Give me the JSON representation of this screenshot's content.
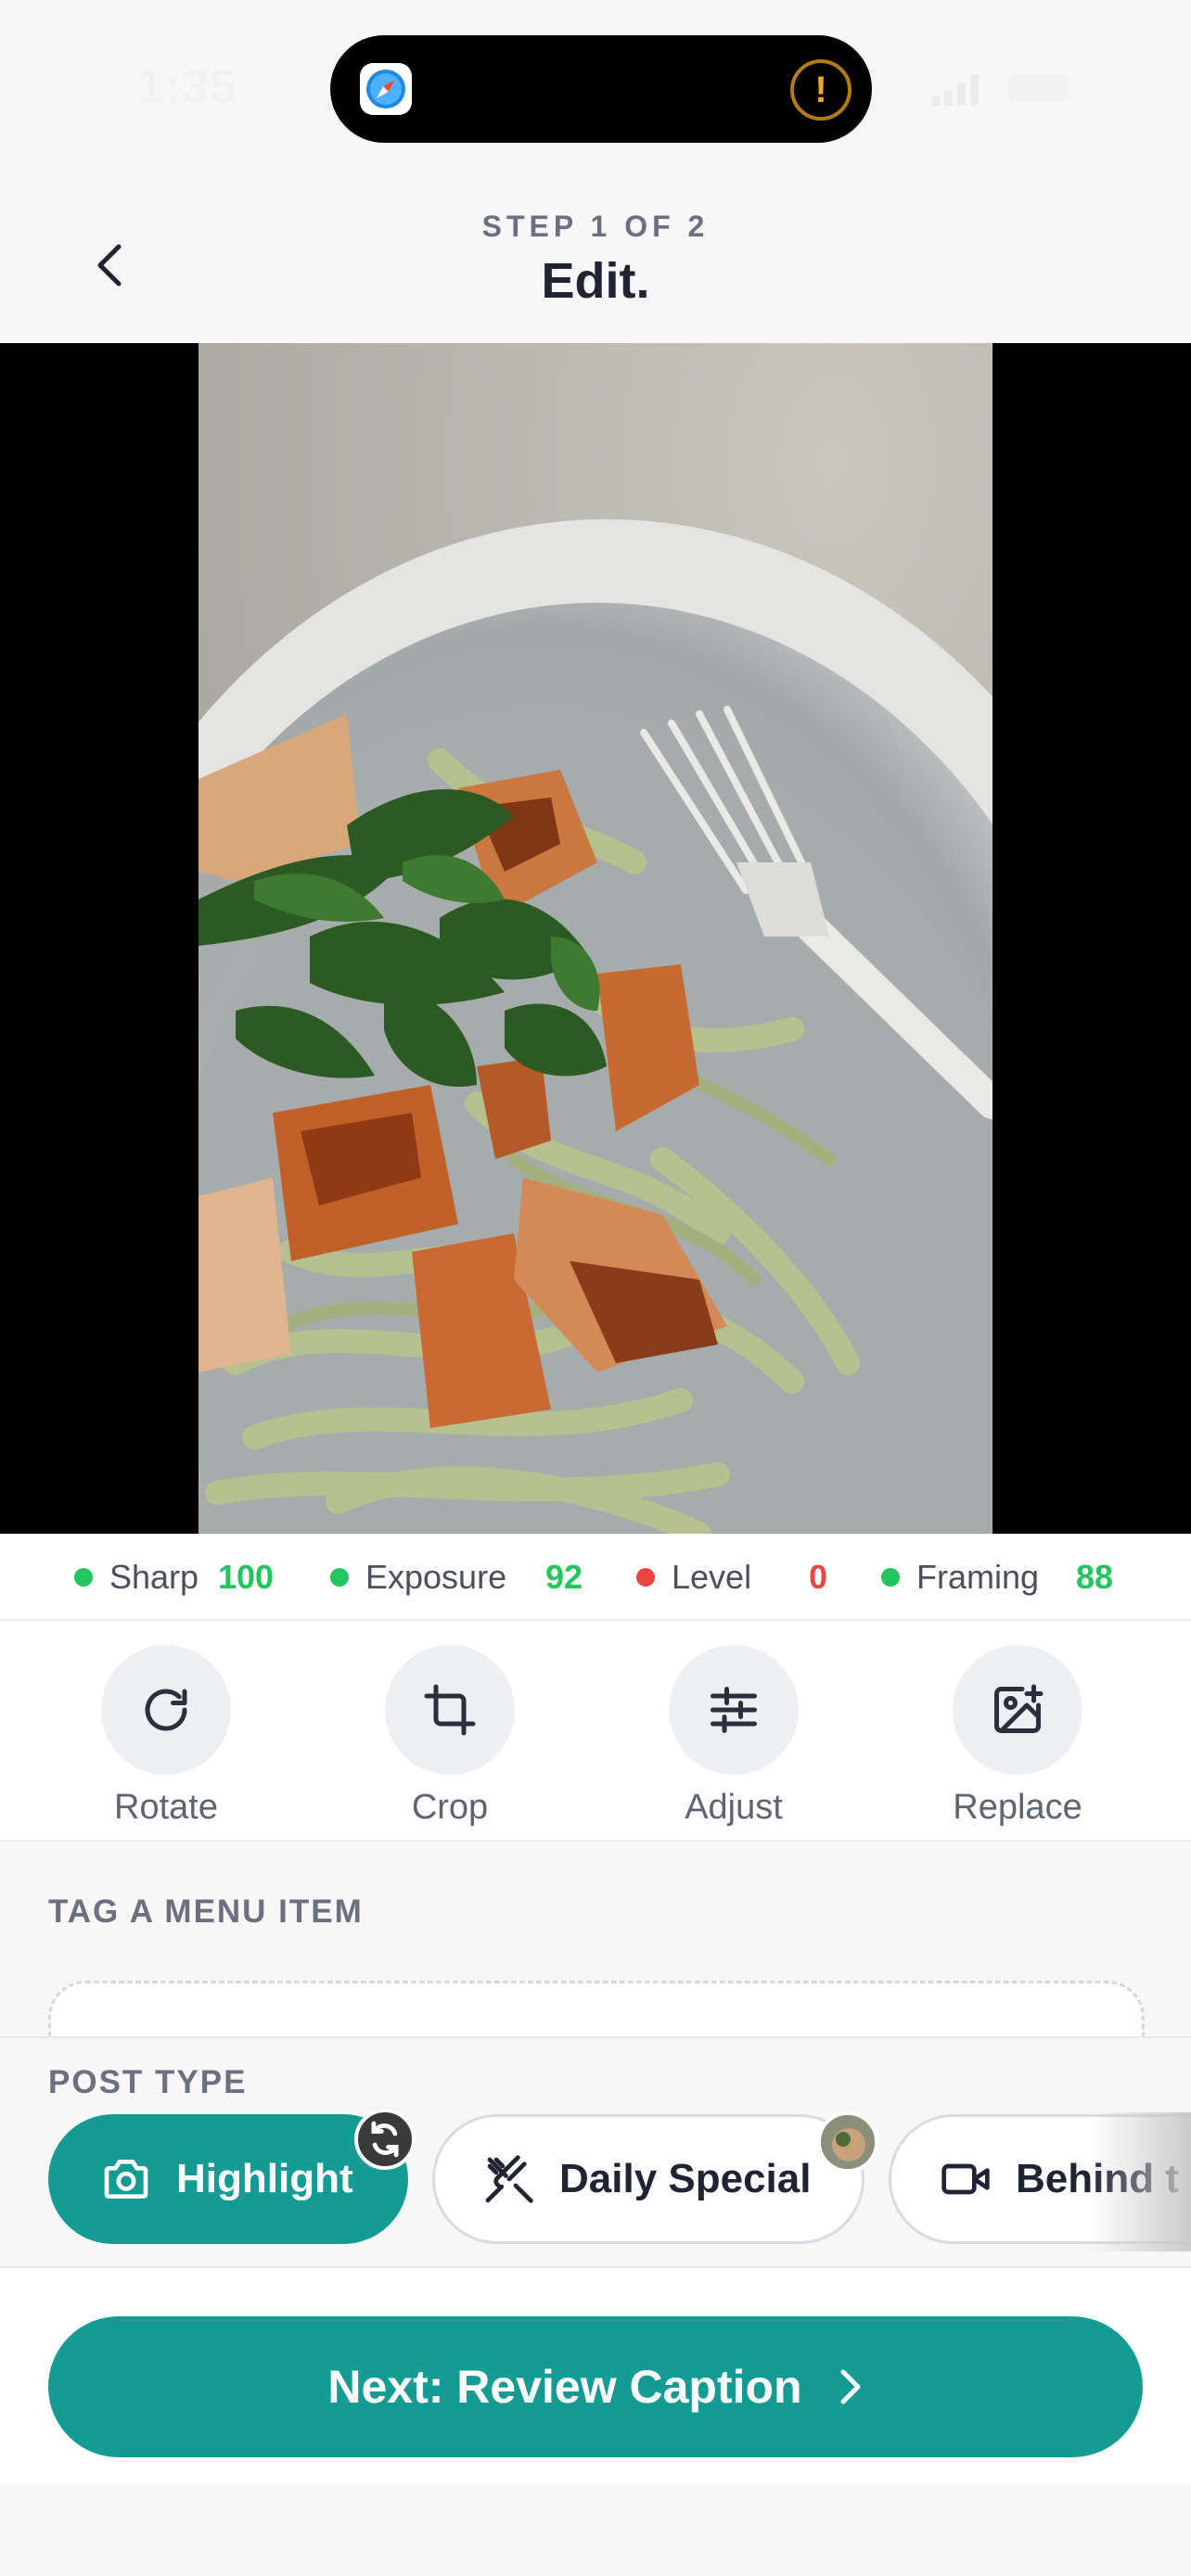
{
  "status_bar": {
    "time": "1:35",
    "alert_glyph": "!"
  },
  "header": {
    "back_icon": "chevron-left-icon",
    "step_label": "STEP 1 OF 2",
    "title": "Edit."
  },
  "photo": {
    "description_icon": "food-photo"
  },
  "metrics": [
    {
      "label": "Sharp",
      "value": "100",
      "status_color": "#22c55e"
    },
    {
      "label": "Exposure",
      "value": "92",
      "status_color": "#22c55e"
    },
    {
      "label": "Level",
      "value": "0",
      "status_color": "#ef4444"
    },
    {
      "label": "Framing",
      "value": "88",
      "status_color": "#22c55e"
    }
  ],
  "tools": [
    {
      "label": "Rotate",
      "icon": "rotate-icon"
    },
    {
      "label": "Crop",
      "icon": "crop-icon"
    },
    {
      "label": "Adjust",
      "icon": "sliders-icon"
    },
    {
      "label": "Replace",
      "icon": "image-plus-icon"
    }
  ],
  "tag_section": {
    "heading": "TAG A MENU ITEM"
  },
  "post_type": {
    "heading": "POST TYPE",
    "options": [
      {
        "label": "Highlight",
        "icon": "camera-icon",
        "selected": true
      },
      {
        "label": "Daily Special",
        "icon": "utensils-crossed-icon",
        "selected": false
      },
      {
        "label": "Behind t",
        "icon": "video-icon",
        "selected": false
      }
    ]
  },
  "footer": {
    "next_label": "Next: Review Caption"
  },
  "colors": {
    "accent": "#149c94",
    "good": "#22c55e",
    "bad": "#ef4444"
  }
}
